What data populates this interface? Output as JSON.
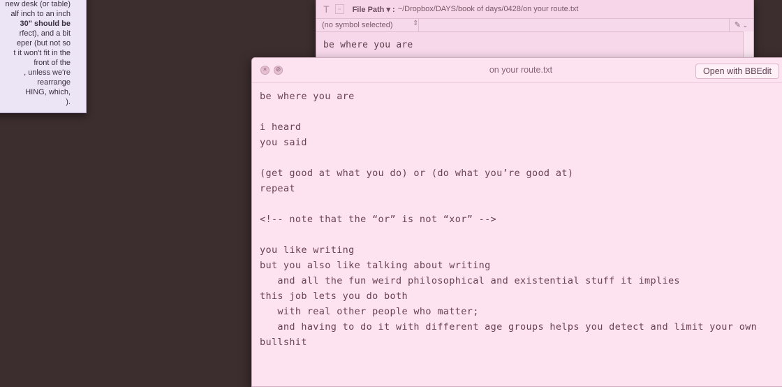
{
  "note": {
    "lines": [
      "new desk (or table)",
      "alf inch to an inch",
      "30\" should be",
      "rfect), and a bit",
      "eper (but not so",
      "t it won't fit in the",
      "front of the",
      ", unless we're",
      "rearrange",
      "HING, which,",
      ")."
    ]
  },
  "back_window": {
    "file_path_label": "File Path ▾ :",
    "file_path_value": "~/Dropbox/DAYS/book of days/0428/on your route.txt",
    "symbol_select": "(no symbol selected)",
    "text_line": "be where you are"
  },
  "front_window": {
    "title": "on your route.txt",
    "open_button": "Open with BBEdit",
    "lines": [
      "be where you are",
      "",
      "i heard",
      "you said",
      "",
      "(get good at what you do) or (do what you’re good at)",
      "repeat",
      "",
      "<!-- note that the “or” is not “xor” -->",
      "",
      "you like writing",
      "but you also like talking about writing",
      "   and all the fun weird philosophical and existential stuff it implies",
      "this job lets you do both",
      "   with real other people who matter;",
      "   and having to do it with different age groups helps you detect and limit your own",
      "bullshit"
    ]
  }
}
